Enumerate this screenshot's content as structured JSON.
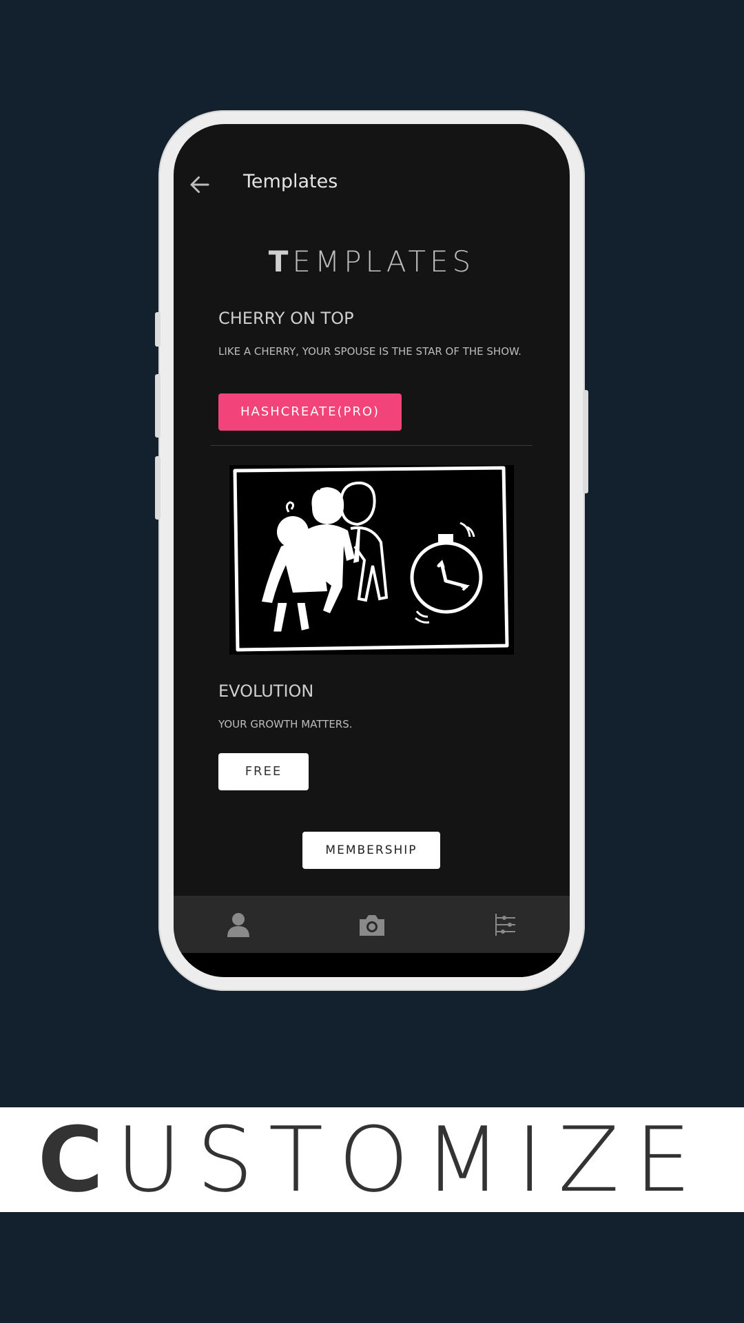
{
  "appbar": {
    "title": "Templates"
  },
  "page": {
    "heading_first": "T",
    "heading_rest": "EMPLATES"
  },
  "templates": [
    {
      "title": "CHERRY ON TOP",
      "subtitle": "LIKE A CHERRY, YOUR SPOUSE IS THE STAR OF THE SHOW.",
      "button_label": "HASHCREATE(PRO)"
    },
    {
      "title": "EVOLUTION",
      "subtitle": "YOUR GROWTH MATTERS.",
      "button_label": "FREE"
    }
  ],
  "membership_button": "MEMBERSHIP",
  "tabs": [
    {
      "icon": "profile-icon"
    },
    {
      "icon": "camera-icon"
    },
    {
      "icon": "settings-sliders-icon"
    }
  ],
  "banner": {
    "first": "C",
    "rest": "USTOMIZE"
  },
  "colors": {
    "background": "#13202d",
    "screen": "#141414",
    "accent_pink": "#f2437a",
    "tabbar": "#2a2a2a"
  }
}
